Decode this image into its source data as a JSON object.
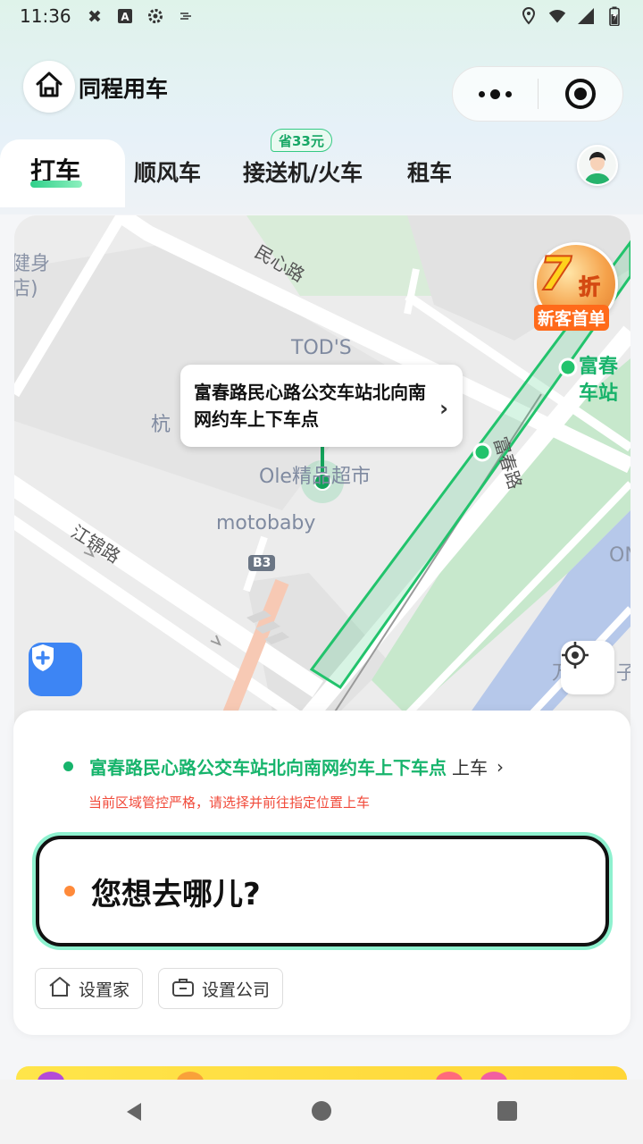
{
  "status_bar": {
    "time": "11:36",
    "left_icons": [
      "data-saver-icon",
      "a-icon",
      "settings-icon",
      "cast-icon"
    ],
    "right_icons": [
      "location-icon",
      "wifi-icon",
      "signal-icon",
      "battery-icon"
    ]
  },
  "header": {
    "app_title": "同程用车",
    "home_icon": "home-icon",
    "more_icon": "more-dots-icon",
    "close_icon": "target-close-icon"
  },
  "tabs": {
    "items": [
      {
        "label": "打车",
        "active": true
      },
      {
        "label": "顺风车",
        "active": false
      },
      {
        "label": "接送机/火车",
        "active": false
      },
      {
        "label": "租车",
        "active": false
      }
    ],
    "promo_badge": "省33元"
  },
  "map": {
    "pickup_bubble": "富春路民心路公交车站北向南网约车上下车点",
    "discount": {
      "value": "7",
      "unit": "折",
      "subtitle": "新客首单"
    },
    "labels": {
      "partial_gym_1": "健身",
      "partial_gym_2": "店)",
      "minxin_road": "民心路",
      "tods": "TOD'S",
      "hang": "杭",
      "ole_market": "Ole精品超市",
      "motobaby": "motobaby",
      "jiangjin_road": "江锦路",
      "b3": "B3",
      "fuchun_road": "富春路",
      "station_1": "富春",
      "station_2": "车站",
      "partial_on": "ON",
      "partial_bottom": "万",
      "partial_bottom_2": "子"
    },
    "colors": {
      "route": "#22c36c",
      "river": "#b6c8ea",
      "park": "#c7e8cc"
    }
  },
  "card": {
    "pickup_name": "富春路民心路公交车站北向南网约车上下车点",
    "pickup_suffix": "上车",
    "warning": "当前区域管控严格，请选择并前往指定位置上车",
    "destination_placeholder": "您想去哪儿?",
    "quick_home": "设置家",
    "quick_company": "设置公司"
  },
  "colors": {
    "accent_green": "#17b46c",
    "warning_red": "#f14a3a",
    "shield_blue": "#3d85f4",
    "origin_dot": "#ff8a3a"
  }
}
